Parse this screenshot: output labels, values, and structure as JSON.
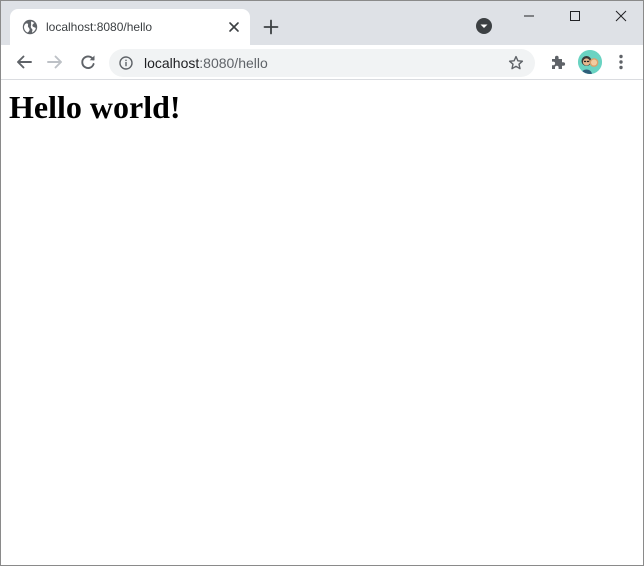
{
  "browser": {
    "tab": {
      "title": "localhost:8080/hello",
      "favicon": "globe-icon"
    },
    "address_bar": {
      "host": "localhost",
      "path": ":8080/hello"
    },
    "icons": {
      "back": "arrow-left-icon",
      "forward": "arrow-right-icon",
      "reload": "reload-icon",
      "info": "info-icon",
      "bookmark": "star-icon",
      "extensions": "puzzle-icon",
      "menu": "kebab-menu-icon",
      "new_tab": "plus-icon",
      "tab_search": "chevron-down-circle-icon",
      "minimize": "minimize-icon",
      "maximize": "maximize-icon",
      "close": "close-icon"
    },
    "colors": {
      "tabstrip": "#dee1e6",
      "omnibox": "#f1f3f4",
      "avatar": "#6ad3c2",
      "icon": "#5f6368"
    }
  },
  "page": {
    "heading": "Hello world!"
  }
}
